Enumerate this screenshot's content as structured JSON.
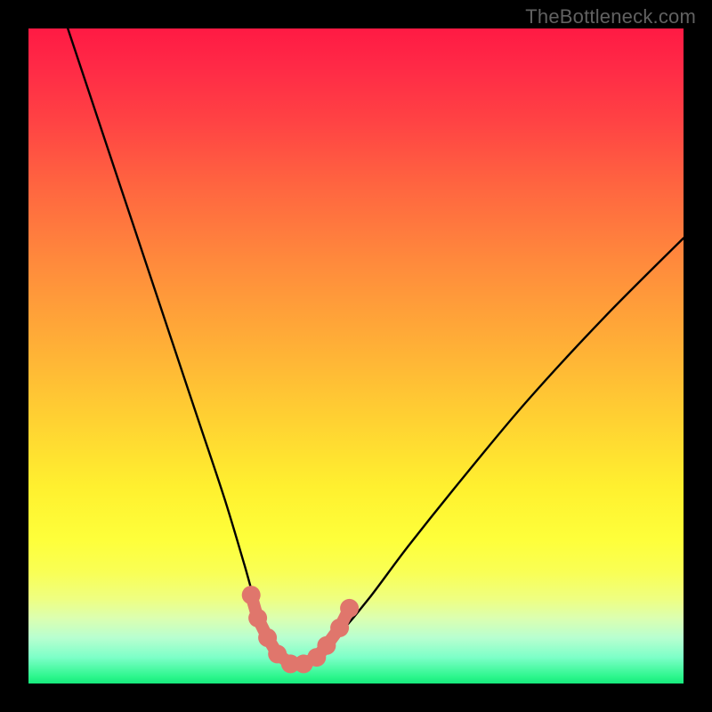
{
  "watermark": "TheBottleneck.com",
  "chart_data": {
    "type": "line",
    "title": "",
    "xlabel": "",
    "ylabel": "",
    "xlim": [
      0,
      100
    ],
    "ylim": [
      0,
      100
    ],
    "grid": false,
    "legend": false,
    "series": [
      {
        "name": "bottleneck-curve",
        "x": [
          6,
          10,
          14,
          18,
          22,
          26,
          30,
          33,
          35,
          37,
          38.5,
          40,
          42,
          44,
          47,
          52,
          58,
          66,
          76,
          88,
          100
        ],
        "y": [
          100,
          88,
          76,
          64,
          52,
          40,
          28,
          18,
          11,
          6,
          4,
          3,
          3,
          4,
          7,
          13,
          21,
          31,
          43,
          56,
          68
        ]
      }
    ],
    "markers": {
      "name": "highlight-nodes",
      "color": "#e0766c",
      "points": [
        {
          "x": 34.0,
          "y": 13.5
        },
        {
          "x": 35.0,
          "y": 10.0
        },
        {
          "x": 36.5,
          "y": 7.0
        },
        {
          "x": 38.0,
          "y": 4.5
        },
        {
          "x": 40.0,
          "y": 3.0
        },
        {
          "x": 42.0,
          "y": 3.0
        },
        {
          "x": 44.0,
          "y": 4.0
        },
        {
          "x": 45.5,
          "y": 5.8
        },
        {
          "x": 47.5,
          "y": 8.5
        },
        {
          "x": 49.0,
          "y": 11.5
        }
      ]
    },
    "background_gradient": {
      "top": "#ff1a44",
      "mid": "#ffd232",
      "bottom": "#17e97c"
    }
  }
}
